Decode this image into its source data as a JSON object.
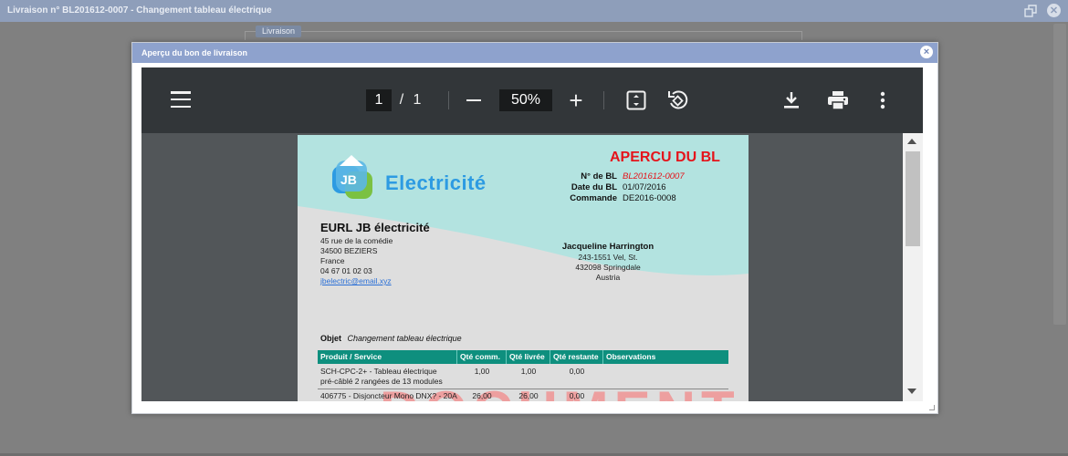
{
  "background": {
    "window_title": "Livraison n° BL201612-0007 - Changement tableau électrique",
    "tab_label": "Livraison"
  },
  "modal": {
    "title": "Aperçu du bon de livraison",
    "close": "×"
  },
  "viewer": {
    "current_page": "1",
    "separator": "/",
    "total_pages": "1",
    "zoom": "50%",
    "plus": "+"
  },
  "document": {
    "logo_text": "Electricité",
    "title": "APERCU DU BL",
    "meta": [
      {
        "label": "N° de BL",
        "value": "BL201612-0007"
      },
      {
        "label": "Date du BL",
        "value": "01/07/2016"
      },
      {
        "label": "Commande",
        "value": "DE2016-0008"
      }
    ],
    "company": {
      "name": "EURL JB électricité",
      "lines": [
        "45 rue de la comédie",
        "34500 BEZIERS",
        "France",
        "04 67 01 02 03"
      ],
      "email": "jbelectric@email.xyz"
    },
    "recipient": {
      "name": "Jacqueline Harrington",
      "lines": [
        "243-1551 Vel, St.",
        "432098 Springdale",
        "Austria"
      ]
    },
    "objet_label": "Objet",
    "objet_value": "Changement tableau électrique",
    "table": {
      "headers": [
        "Produit / Service",
        "Qté comm.",
        "Qté livrée",
        "Qté restante",
        "Observations"
      ],
      "rows": [
        {
          "product": "SCH-CPC-2+ - Tableau électrique",
          "product2": "pré-câblé 2 rangées de 13 modules",
          "ordered": "1,00",
          "delivered": "1,00",
          "remaining": "0,00"
        },
        {
          "product": "406775 - Disjoncteur Mono DNX? - 20A",
          "product2": "",
          "ordered": "26,00",
          "delivered": "26,00",
          "remaining": "0,00"
        }
      ]
    },
    "watermark": "DOCUMENT"
  }
}
